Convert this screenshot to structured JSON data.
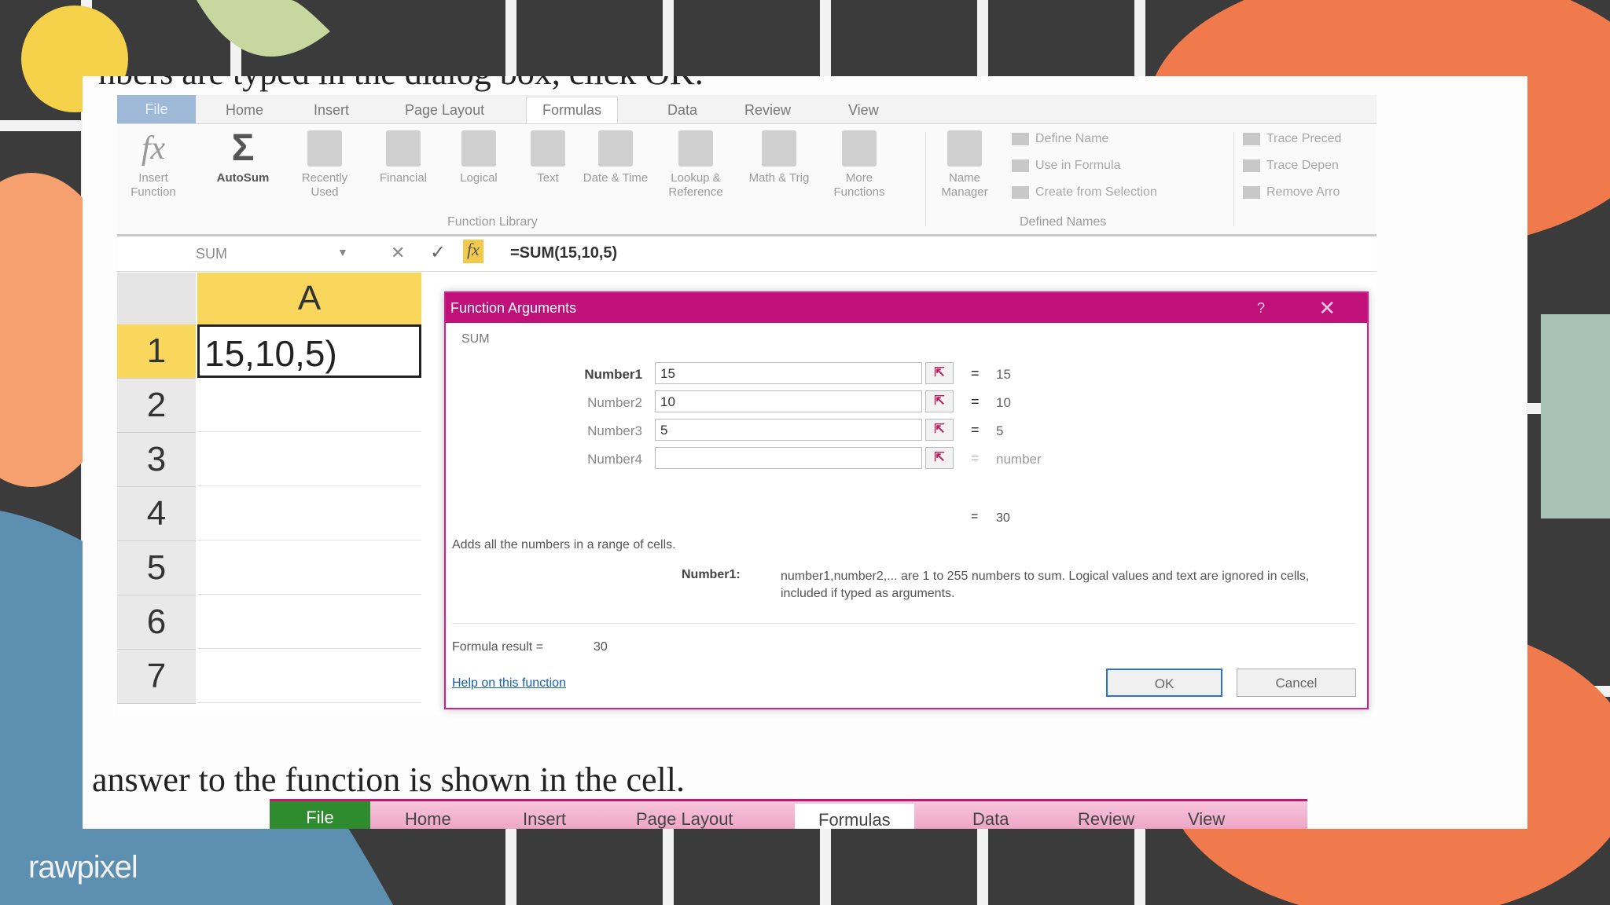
{
  "slide": {
    "top_text": "nbers are typed in the dialog box, click OK.",
    "bottom_text": "answer to the function is shown in the cell."
  },
  "tabs": [
    "File",
    "Home",
    "Insert",
    "Page Layout",
    "Formulas",
    "Data",
    "Review",
    "View"
  ],
  "ribbon": {
    "insert_function": "Insert Function",
    "autosum": "AutoSum",
    "recently_used": "Recently Used",
    "financial": "Financial",
    "logical": "Logical",
    "text": "Text",
    "date_time": "Date & Time",
    "lookup_reference": "Lookup & Reference",
    "math_trig": "Math & Trig",
    "more_functions": "More Functions",
    "function_library": "Function Library",
    "name_manager": "Name Manager",
    "define_name": "Define Name",
    "use_in_formula": "Use in Formula",
    "create_from_selection": "Create from Selection",
    "defined_names": "Defined Names",
    "trace_precedents": "Trace Preced",
    "trace_dependents": "Trace Depen",
    "remove_arrows": "Remove Arro"
  },
  "formula_bar": {
    "name_box": "SUM",
    "fx": "fx",
    "formula": "=SUM(15,10,5)"
  },
  "sheet": {
    "column": "A",
    "rows": [
      "1",
      "2",
      "3",
      "4",
      "5",
      "6",
      "7"
    ],
    "cell_a1": "15,10,5)"
  },
  "dialog": {
    "title": "Function Arguments",
    "help": "?",
    "close": "✕",
    "function_name": "SUM",
    "args": [
      {
        "label": "Number1",
        "value": "15",
        "result": "15"
      },
      {
        "label": "Number2",
        "value": "10",
        "result": "10"
      },
      {
        "label": "Number3",
        "value": "5",
        "result": "5"
      },
      {
        "label": "Number4",
        "value": "",
        "result": "number"
      }
    ],
    "total": "30",
    "description": "Adds all the numbers in a range of cells.",
    "arg_help_label": "Number1:",
    "arg_help_text": "number1,number2,... are 1 to 255 numbers to sum. Logical values and text are ignored in cells, included if typed as arguments.",
    "formula_result_label": "Formula result =",
    "formula_result": "30",
    "help_link": "Help on this function",
    "ok": "OK",
    "cancel": "Cancel"
  },
  "bottom_tabs": [
    "File",
    "Home",
    "Insert",
    "Page Layout",
    "Formulas",
    "Data",
    "Review",
    "View"
  ],
  "watermark": "rawpixel"
}
